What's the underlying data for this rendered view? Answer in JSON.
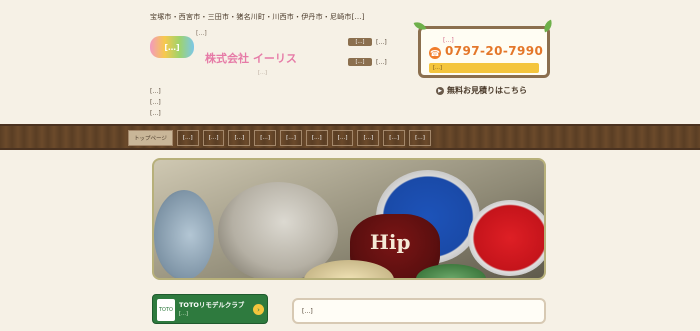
{
  "header": {
    "service_area": "宝塚市・西宮市・三田市・猪名川町・川西市・伊丹市・尼崎市[…]",
    "logo_text": "[…]",
    "tagline": "[…]",
    "company_name": "株式会社 イーリス",
    "motto": "[…]",
    "address_lines": [
      "[…]",
      "[…]",
      "[…]"
    ]
  },
  "contact": {
    "rows": [
      {
        "tag": "[…]",
        "value": "[…]"
      },
      {
        "tag": "[…]",
        "value": "[…]"
      }
    ]
  },
  "phone_box": {
    "lead": "[…]",
    "icon": "phone-icon",
    "number": "0797-20-7990",
    "link_label": "[…]"
  },
  "estimate": {
    "icon": "arrow-right-icon",
    "label": "無料お見積りはこちら"
  },
  "nav": {
    "items": [
      {
        "label": "トップページ",
        "active": true
      },
      {
        "label": "[…]",
        "active": false
      },
      {
        "label": "[…]",
        "active": false
      },
      {
        "label": "[…]",
        "active": false
      },
      {
        "label": "[…]",
        "active": false
      },
      {
        "label": "[…]",
        "active": false
      },
      {
        "label": "[…]",
        "active": false
      },
      {
        "label": "[…]",
        "active": false
      },
      {
        "label": "[…]",
        "active": false
      },
      {
        "label": "[…]",
        "active": false
      },
      {
        "label": "[…]",
        "active": false
      }
    ]
  },
  "hero": {
    "can_label": "Hip"
  },
  "toto_banner": {
    "logo_text": "TOTO",
    "title": "TOTOリモデルクラブ",
    "subtitle": "[…]",
    "arrow_icon": "arrow-right-icon"
  },
  "intro_text": "[…]"
}
